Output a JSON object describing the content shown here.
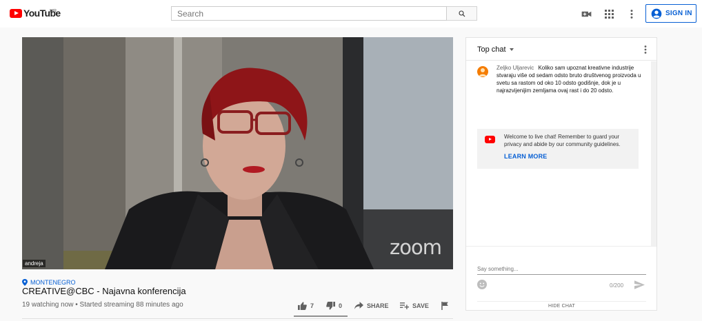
{
  "header": {
    "logo_text": "YouTube",
    "logo_country": "HR",
    "search_placeholder": "Search",
    "signin_label": "SIGN IN"
  },
  "player": {
    "speaker_label": "andreja",
    "watermark": "zoom"
  },
  "video": {
    "location": "MONTENEGRO",
    "title": "CREATIVE@CBC - Najavna konferencija",
    "watch_info": "19 watching now • Started streaming 88 minutes ago",
    "like_count": "7",
    "dislike_count": "0",
    "share_label": "SHARE",
    "save_label": "SAVE",
    "like_ratio": 1.0
  },
  "chat": {
    "mode": "Top chat",
    "message": {
      "author": "Zeljko Uljarevic",
      "text": "Koliko sam upoznat kreativne industrije stvaraju više od sedam odsto bruto društvenog proizvoda u svetu sa rastom od oko 10 odsto godišnje, dok je u najrazvijenijim zemljama ovaj rast i do 20 odsto."
    },
    "notice": {
      "text": "Welcome to live chat! Remember to guard your privacy and abide by our community guidelines.",
      "link": "LEARN MORE"
    },
    "input_placeholder": "Say something...",
    "char_count": "0/200",
    "hide_label": "HIDE CHAT"
  },
  "colors": {
    "brand_red": "#ff0000",
    "link_blue": "#065fd4",
    "avatar_orange": "#f57c00"
  }
}
